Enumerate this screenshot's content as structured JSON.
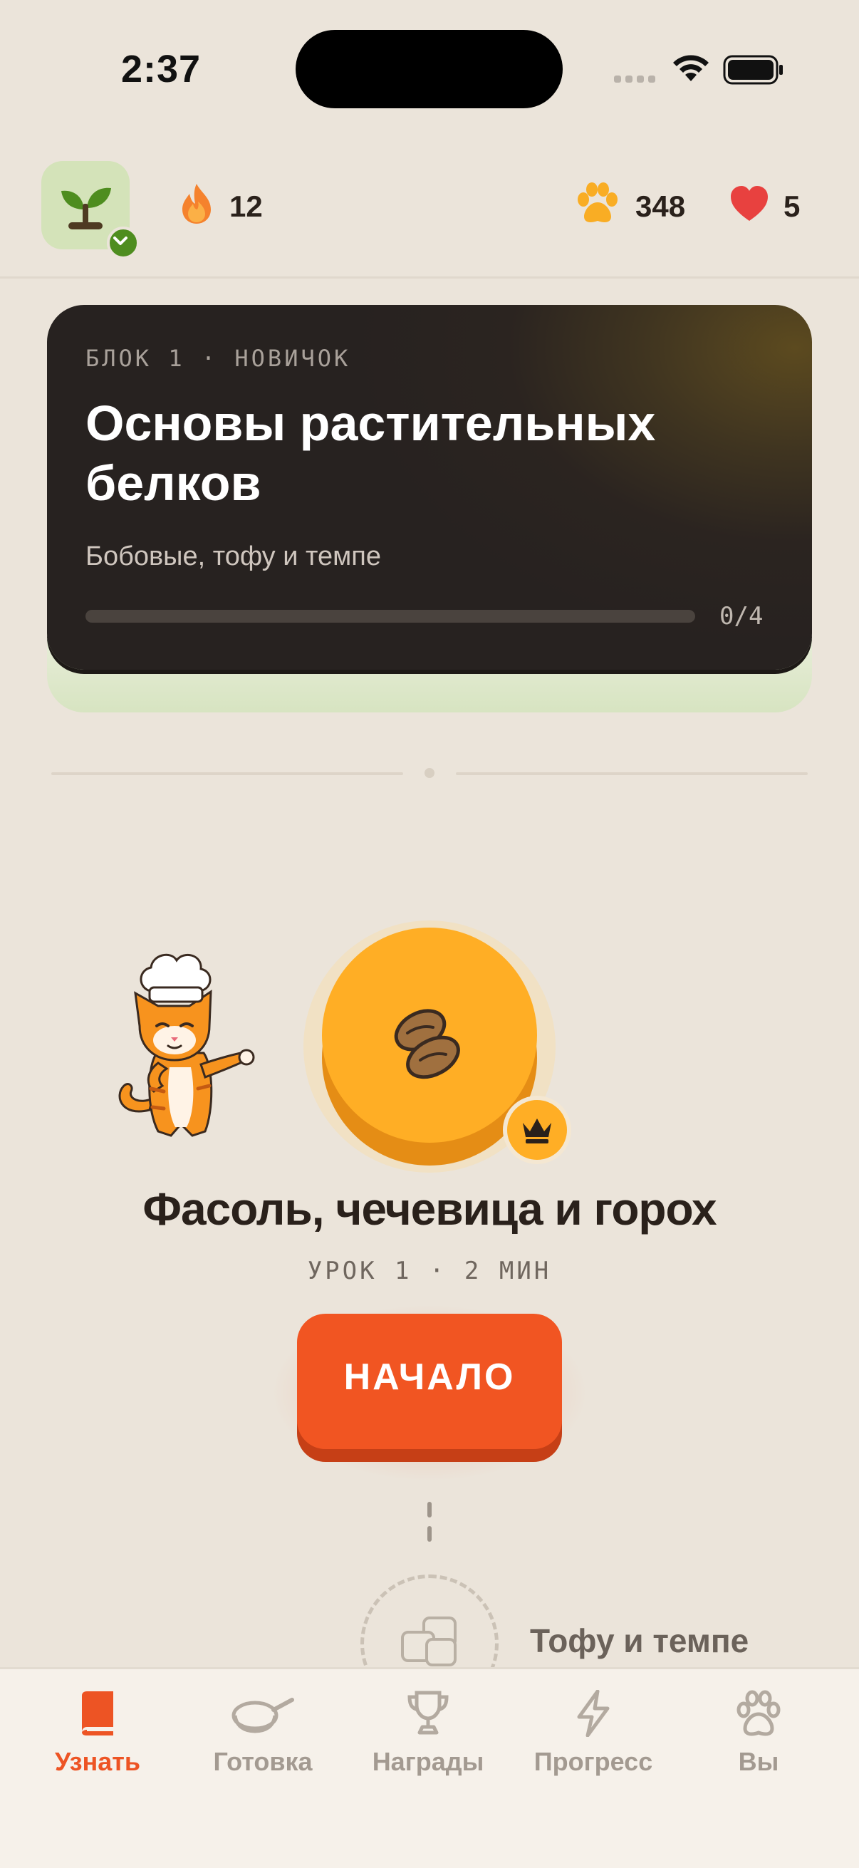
{
  "status_bar": {
    "time": "2:37"
  },
  "header": {
    "streak": "12",
    "paws": "348",
    "hearts": "5"
  },
  "block_card": {
    "kicker": "БЛОК 1 · НОВИЧОК",
    "title": "Основы растительных белков",
    "subtitle": "Бобовые, тофу и темпе",
    "progress": "0/4",
    "progress_fraction": 0
  },
  "lesson": {
    "title": "Фасоль, чечевица и горох",
    "meta": "УРОК 1 · 2 МИН",
    "start_label": "НАЧАЛО"
  },
  "next_lesson": {
    "title": "Тофу и темпе"
  },
  "tabs": [
    {
      "label": "Узнать",
      "icon": "book-icon",
      "active": true
    },
    {
      "label": "Готовка",
      "icon": "pan-icon",
      "active": false
    },
    {
      "label": "Награды",
      "icon": "trophy-icon",
      "active": false
    },
    {
      "label": "Прогресс",
      "icon": "lightning-icon",
      "active": false
    },
    {
      "label": "Вы",
      "icon": "paw-icon",
      "active": false
    }
  ],
  "colors": {
    "background": "#ebe4da",
    "accent": "#f15522",
    "node": "#ffae25",
    "card": "#2b2420"
  }
}
